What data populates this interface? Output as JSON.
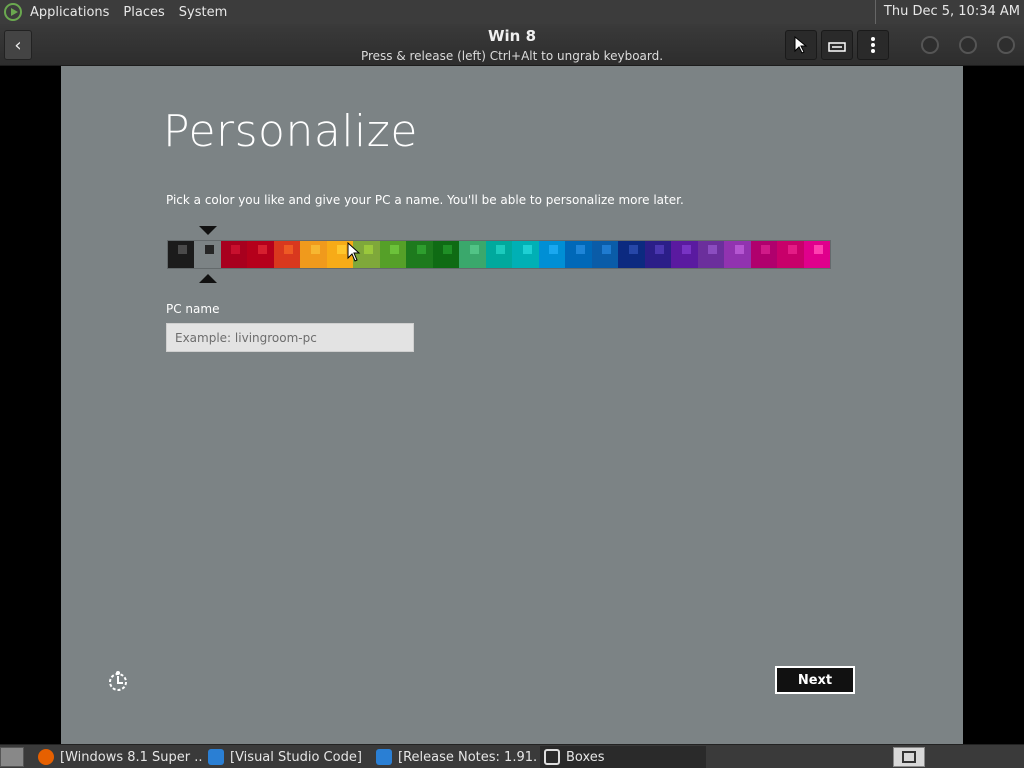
{
  "top_panel": {
    "menus": [
      "Applications",
      "Places",
      "System"
    ],
    "clock": "Thu Dec  5, 10:34 AM"
  },
  "header": {
    "title": "Win 8",
    "subtitle": "Press & release (left) Ctrl+Alt to ungrab keyboard."
  },
  "setup": {
    "heading": "Personalize",
    "instructions": "Pick a color you like and give your PC a name. You'll be able to personalize more later.",
    "pc_name_label": "PC name",
    "pc_name_placeholder": "Example: livingroom-pc",
    "pc_name_value": "",
    "next_label": "Next",
    "selected_swatch_index": 1,
    "swatches": [
      {
        "bg": "#1b1b1b",
        "sq": "#4a4a4a"
      },
      {
        "bg": "#7c8385",
        "sq": "#262626"
      },
      {
        "bg": "#a8001e",
        "sq": "#c8102e"
      },
      {
        "bg": "#b5001b",
        "sq": "#d61f2f"
      },
      {
        "bg": "#d9381e",
        "sq": "#ee5a24"
      },
      {
        "bg": "#f09a1c",
        "sq": "#f7b731"
      },
      {
        "bg": "#f7ab17",
        "sq": "#ffc72c"
      },
      {
        "bg": "#7fa83a",
        "sq": "#9ac83c"
      },
      {
        "bg": "#55a028",
        "sq": "#6cc23a"
      },
      {
        "bg": "#1d7a1d",
        "sq": "#2e9e2e"
      },
      {
        "bg": "#0f6b14",
        "sq": "#1f8f26"
      },
      {
        "bg": "#3aa86c",
        "sq": "#52c486"
      },
      {
        "bg": "#00a99d",
        "sq": "#1ccbbd"
      },
      {
        "bg": "#00b0b5",
        "sq": "#1ed0d4"
      },
      {
        "bg": "#008fd5",
        "sq": "#1aa8f0"
      },
      {
        "bg": "#0068b8",
        "sq": "#1e85d8"
      },
      {
        "bg": "#0a5ca8",
        "sq": "#1f7bd0"
      },
      {
        "bg": "#0c2a80",
        "sq": "#2647a8"
      },
      {
        "bg": "#2b1e88",
        "sq": "#4a36b0"
      },
      {
        "bg": "#5a1aa0",
        "sq": "#7833c4"
      },
      {
        "bg": "#6b2f9c",
        "sq": "#8b4dc0"
      },
      {
        "bg": "#9133b0",
        "sq": "#b556d2"
      },
      {
        "bg": "#b0006d",
        "sq": "#d01a88"
      },
      {
        "bg": "#c8006a",
        "sq": "#e41c86"
      },
      {
        "bg": "#e0008c",
        "sq": "#ff3fb0"
      }
    ]
  },
  "taskbar": {
    "tasks": [
      {
        "label": "[Windows 8.1 Super ...",
        "icon": "firefox-icon",
        "color": "#e66000"
      },
      {
        "label": "[Visual Studio Code]",
        "icon": "vscode-icon",
        "color": "#2a7fd4"
      },
      {
        "label": "[Release Notes: 1.91...",
        "icon": "vscode-icon",
        "color": "#2a7fd4"
      },
      {
        "label": "Boxes",
        "icon": "boxes-icon",
        "color": "#dddddd"
      }
    ]
  }
}
